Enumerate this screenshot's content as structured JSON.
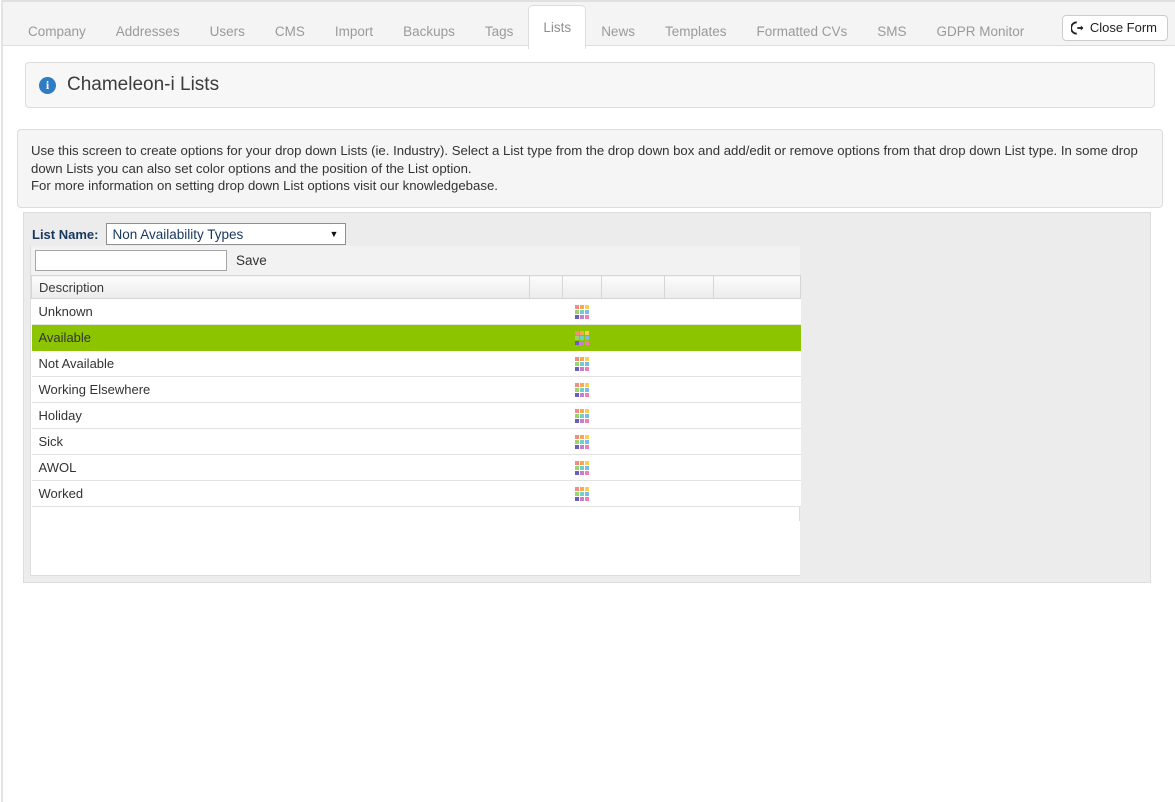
{
  "tabs": [
    {
      "label": "Company",
      "active": false
    },
    {
      "label": "Addresses",
      "active": false
    },
    {
      "label": "Users",
      "active": false
    },
    {
      "label": "CMS",
      "active": false
    },
    {
      "label": "Import",
      "active": false
    },
    {
      "label": "Backups",
      "active": false
    },
    {
      "label": "Tags",
      "active": false
    },
    {
      "label": "Lists",
      "active": true
    },
    {
      "label": "News",
      "active": false
    },
    {
      "label": "Templates",
      "active": false
    },
    {
      "label": "Formatted CVs",
      "active": false
    },
    {
      "label": "SMS",
      "active": false
    },
    {
      "label": "GDPR Monitor",
      "active": false
    }
  ],
  "close_form": {
    "label": "Close Form",
    "icon": "sign-out-icon"
  },
  "header": {
    "icon": "info-icon",
    "icon_glyph": "i",
    "title": "Chameleon-i Lists"
  },
  "instructions": {
    "line1": "Use this screen to create options for your drop down Lists (ie. Industry). Select a List type from the drop down box and add/edit or remove options from that drop down List type. In some drop down Lists you can also set color options and the position of the List option.",
    "line2": "For more information on setting drop down List options visit our knowledgebase."
  },
  "list_selector": {
    "label": "List Name:",
    "selected": "Non Availability Types",
    "caret": "▼",
    "options": [
      "Non Availability Types"
    ]
  },
  "add_row": {
    "input_value": "",
    "input_placeholder": "",
    "save_label": "Save"
  },
  "table": {
    "columns": [
      "Description",
      "",
      "",
      "",
      "",
      ""
    ],
    "rows": [
      {
        "description": "Unknown",
        "color_icon": "color-palette-icon",
        "selected": false
      },
      {
        "description": "Available",
        "color_icon": "color-palette-icon",
        "selected": true
      },
      {
        "description": "Not Available",
        "color_icon": "color-palette-icon",
        "selected": false
      },
      {
        "description": "Working Elsewhere",
        "color_icon": "color-palette-icon",
        "selected": false
      },
      {
        "description": "Holiday",
        "color_icon": "color-palette-icon",
        "selected": false
      },
      {
        "description": "Sick",
        "color_icon": "color-palette-icon",
        "selected": false
      },
      {
        "description": "AWOL",
        "color_icon": "color-palette-icon",
        "selected": false
      },
      {
        "description": "Worked",
        "color_icon": "color-palette-icon",
        "selected": false
      }
    ]
  },
  "colors": {
    "selected_row": "#8cc400",
    "info_icon": "#2e7cc4",
    "label_text": "#17375e",
    "palette_swatches": [
      "#f58a8a",
      "#f7a94b",
      "#f5d24b",
      "#9ed36a",
      "#6ecfcf",
      "#7fb8f0",
      "#6a5fb8",
      "#c47fd0",
      "#f07fb0"
    ]
  }
}
